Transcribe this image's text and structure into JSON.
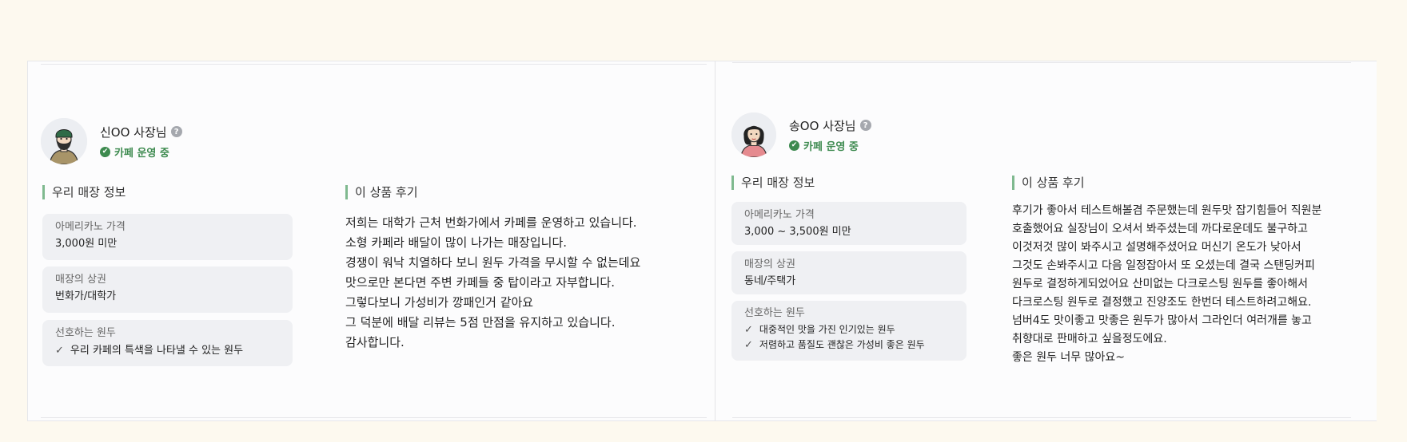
{
  "reviews": [
    {
      "owner_name": "신OO 사장님",
      "help_glyph": "?",
      "status": "카페 운영 중",
      "store_section_title": "우리 매장 정보",
      "review_section_title": "이 상품 후기",
      "price_label": "아메리카노 가격",
      "price_value": "3,000원 미만",
      "district_label": "매장의 상권",
      "district_value": "번화가/대학가",
      "bean_label": "선호하는 원두",
      "bean_prefs": [
        "우리 카페의 특색을 나타낼 수 있는 원두"
      ],
      "review_lines": [
        "저희는 대학가 근처 번화가에서 카페를 운영하고 있습니다.",
        "소형 카페라 배달이 많이 나가는 매장입니다.",
        "경쟁이 워낙 치열하다 보니 원두 가격을 무시할 수 없는데요",
        "맛으로만 본다면 주변 카페들 중 탑이라고 자부합니다.",
        "그렇다보니 가성비가 깡패인거 같아요",
        "그 덕분에 배달 리뷰는 5점 만점을 유지하고 있습니다.",
        "감사합니다."
      ]
    },
    {
      "owner_name": "송OO 사장님",
      "help_glyph": "?",
      "status": "카페 운영 중",
      "store_section_title": "우리 매장 정보",
      "review_section_title": "이 상품 후기",
      "price_label": "아메리카노 가격",
      "price_value": "3,000 ~ 3,500원 미만",
      "district_label": "매장의 상권",
      "district_value": "동네/주택가",
      "bean_label": "선호하는 원두",
      "bean_prefs": [
        "대중적인 맛을 가진 인기있는 원두",
        "저렴하고 품질도 괜찮은 가성비 좋은 원두"
      ],
      "review_lines": [
        "후기가 좋아서 테스트해볼겸 주문했는데 원두맛 잡기힘들어 직원분",
        "호출했어요 실장님이 오셔서 봐주셨는데 까다로운데도 불구하고",
        "이것저것 많이 봐주시고 설명해주셨어요 머신기 온도가 낮아서",
        "그것도 손봐주시고 다음 일정잡아서 또 오셨는데 결국 스탠딩커피",
        "원두로 결정하게되었어요 산미없는 다크로스팅 원두를 좋아해서",
        "다크로스팅 원두로 결정했고 진양조도 한번더 테스트하려고해요.",
        "넘버4도 맛이좋고 맛좋은 원두가 많아서 그라인더 여러개를 놓고",
        "취향대로 판매하고 싶을정도에요.",
        "좋은 원두 너무 많아요~"
      ]
    }
  ],
  "icons": {
    "verified": "✔",
    "check": "✓"
  },
  "colors": {
    "background": "#fdf9ef",
    "accent_green": "#3d8a4f",
    "section_bar": "#7fb98f",
    "info_box": "#eff0f3"
  }
}
